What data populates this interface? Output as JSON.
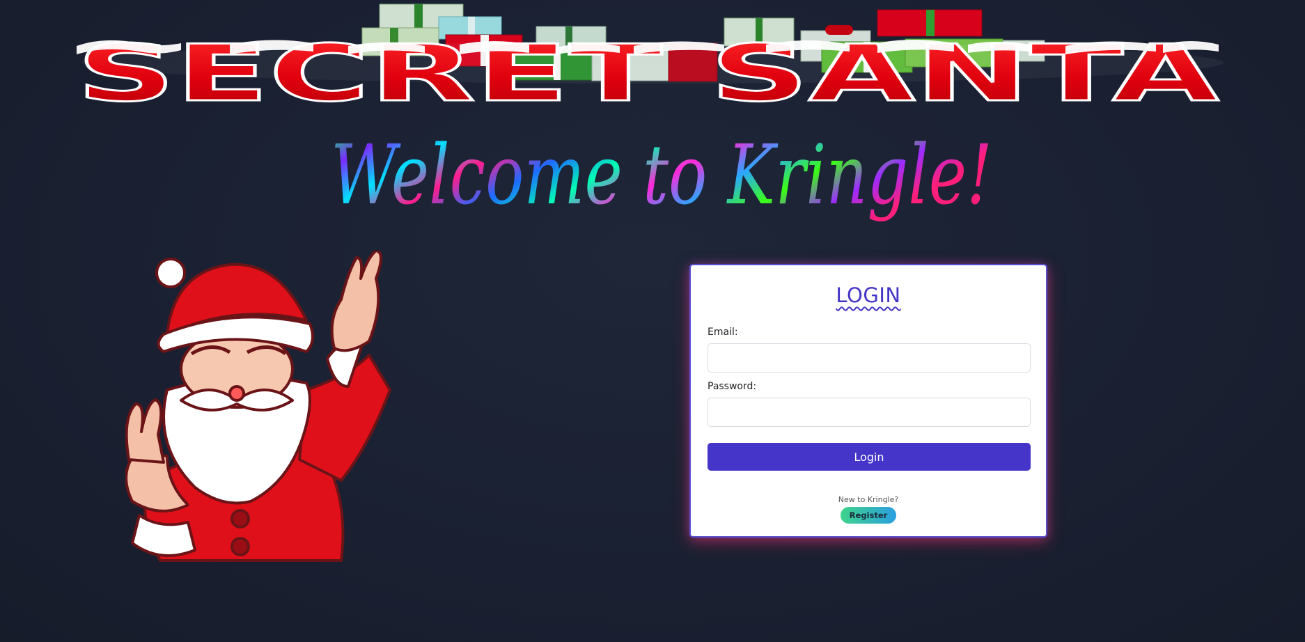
{
  "banner": {
    "title": "SECRET SANTA"
  },
  "welcome": {
    "text": "Welcome to Kringle!"
  },
  "login": {
    "title": "LOGIN",
    "email_label": "Email:",
    "email_value": "",
    "password_label": "Password:",
    "password_value": "",
    "submit_label": "Login",
    "new_user_text": "New to Kringle?",
    "register_label": "Register"
  },
  "colors": {
    "background": "#1a2031",
    "accent": "#4535c8",
    "banner_red": "#e0000e",
    "register_gradient_start": "#3fd38a",
    "register_gradient_end": "#2a9fe0"
  },
  "icons": {
    "banner": "gift-boxes-icon",
    "mascot": "santa-claus-icon"
  }
}
